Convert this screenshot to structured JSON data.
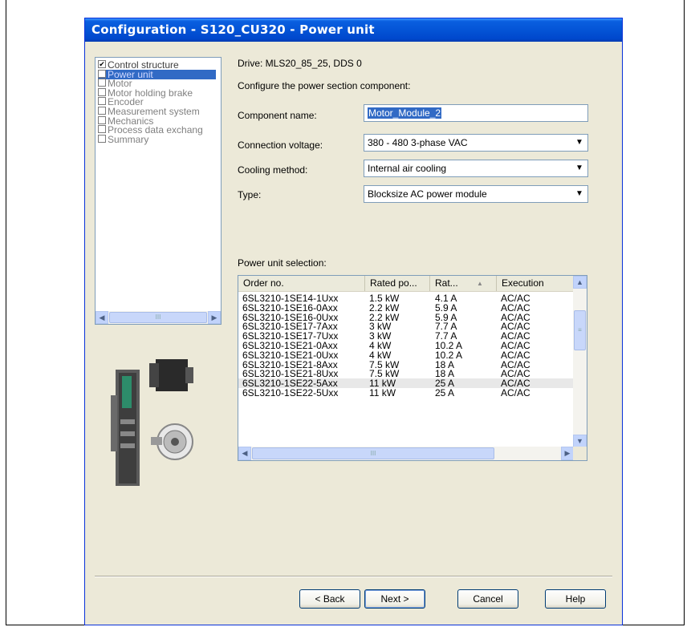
{
  "window": {
    "title": "Configuration - S120_CU320 - Power unit"
  },
  "tree": {
    "items": [
      {
        "label": "Control structure",
        "checked": true,
        "selected": false
      },
      {
        "label": "Power unit",
        "checked": false,
        "selected": true
      },
      {
        "label": "Motor",
        "checked": false,
        "selected": false
      },
      {
        "label": "Motor holding brake",
        "checked": false,
        "selected": false
      },
      {
        "label": "Encoder",
        "checked": false,
        "selected": false
      },
      {
        "label": "Measurement system",
        "checked": false,
        "selected": false
      },
      {
        "label": "Mechanics",
        "checked": false,
        "selected": false
      },
      {
        "label": "Process data exchang",
        "checked": false,
        "selected": false
      },
      {
        "label": "Summary",
        "checked": false,
        "selected": false
      }
    ],
    "scroll_thumb_label": "III"
  },
  "main": {
    "drive_label": "Drive: MLS20_85_25, DDS 0",
    "intro": "Configure the power section component:",
    "component_name": {
      "label": "Component name:",
      "value": "Motor_Module_2"
    },
    "connection_voltage": {
      "label": "Connection voltage:",
      "value": "380 - 480 3-phase VAC"
    },
    "cooling_method": {
      "label": "Cooling method:",
      "value": "Internal air cooling"
    },
    "type": {
      "label": "Type:",
      "value": "Blocksize AC power module"
    },
    "selection_label": "Power unit selection:"
  },
  "table": {
    "columns": [
      "Order no.",
      "Rated po...",
      "Rat...",
      "Execution"
    ],
    "sort_indicator": "▲",
    "rows": [
      [
        "6SL3210-1SE14-1Uxx",
        "1.5 kW",
        "4.1 A",
        "AC/AC"
      ],
      [
        "6SL3210-1SE16-0Axx",
        "2.2 kW",
        "5.9 A",
        "AC/AC"
      ],
      [
        "6SL3210-1SE16-0Uxx",
        "2.2 kW",
        "5.9 A",
        "AC/AC"
      ],
      [
        "6SL3210-1SE17-7Axx",
        "3 kW",
        "7.7 A",
        "AC/AC"
      ],
      [
        "6SL3210-1SE17-7Uxx",
        "3 kW",
        "7.7 A",
        "AC/AC"
      ],
      [
        "6SL3210-1SE21-0Axx",
        "4 kW",
        "10.2 A",
        "AC/AC"
      ],
      [
        "6SL3210-1SE21-0Uxx",
        "4 kW",
        "10.2 A",
        "AC/AC"
      ],
      [
        "6SL3210-1SE21-8Axx",
        "7.5 kW",
        "18 A",
        "AC/AC"
      ],
      [
        "6SL3210-1SE21-8Uxx",
        "7.5 kW",
        "18 A",
        "AC/AC"
      ],
      [
        "6SL3210-1SE22-5Axx",
        "11 kW",
        "25 A",
        "AC/AC"
      ],
      [
        "6SL3210-1SE22-5Uxx",
        "11 kW",
        "25 A",
        "AC/AC"
      ]
    ],
    "highlighted_row": 9,
    "hscroll_thumb_label": "III"
  },
  "buttons": {
    "back": "< Back",
    "next": "Next >",
    "cancel": "Cancel",
    "help": "Help"
  },
  "colors": {
    "title_bar": "#0454d6",
    "selection": "#316ac5",
    "dialog_bg": "#ece9d8"
  }
}
